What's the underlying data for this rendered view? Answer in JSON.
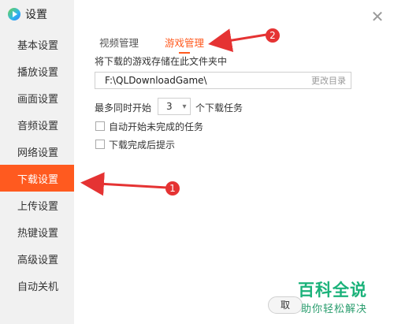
{
  "app": {
    "title": "设置"
  },
  "sidebar": {
    "items": [
      {
        "label": "基本设置"
      },
      {
        "label": "播放设置"
      },
      {
        "label": "画面设置"
      },
      {
        "label": "音频设置"
      },
      {
        "label": "网络设置"
      },
      {
        "label": "下载设置",
        "active": true
      },
      {
        "label": "上传设置"
      },
      {
        "label": "热键设置"
      },
      {
        "label": "高级设置"
      },
      {
        "label": "自动关机"
      }
    ]
  },
  "tabs": {
    "video": "视频管理",
    "game": "游戏管理"
  },
  "game": {
    "storage_label": "将下载的游戏存储在此文件夹中",
    "path_value": "F:\\QLDownloadGame\\",
    "change_dir": "更改目录",
    "max_concurrent_prefix": "最多同时开始",
    "max_concurrent_value": "3",
    "max_concurrent_suffix": "个下载任务",
    "auto_start_label": "自动开始未完成的任务",
    "auto_start_checked": false,
    "notify_label": "下载完成后提示",
    "notify_checked": false
  },
  "footer": {
    "partial_button": "取"
  },
  "annotations": {
    "badge1": "1",
    "badge2": "2"
  },
  "watermark": {
    "title": "百科全说",
    "subtitle": "助你轻松解决"
  },
  "colors": {
    "accent": "#ff5a1f",
    "annotation": "#e53333",
    "watermark": "#1bb27a"
  },
  "icons": {
    "logo": "video-app-logo-icon",
    "close": "close-icon",
    "dropdown": "chevron-down-icon"
  }
}
